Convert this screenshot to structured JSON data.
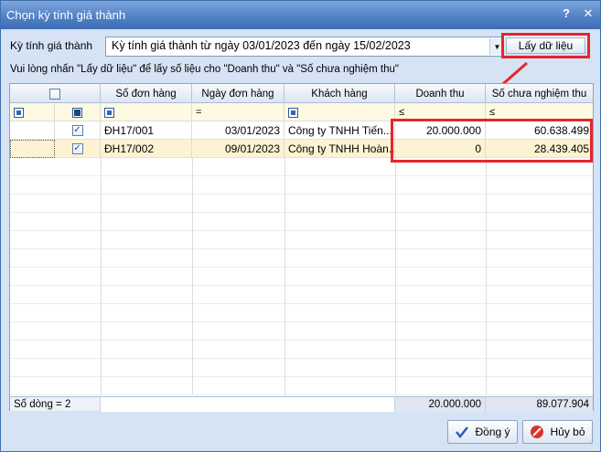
{
  "window": {
    "title": "Chọn kỳ tính giá thành",
    "help": "?",
    "close": "✕"
  },
  "period": {
    "label": "Kỳ tính giá thành",
    "value": "Kỳ tính giá thành từ ngày 03/01/2023 đến ngày 15/02/2023"
  },
  "get_data_label": "Lấy dữ liệu",
  "hint": "Vui lòng nhấn \"Lấy dữ liệu\" để lấy số liệu cho \"Doanh thu\" và \"Số chưa nghiệm thu\"",
  "columns": {
    "order_no": "Số đơn hàng",
    "order_date": "Ngày đơn hàng",
    "customer": "Khách hàng",
    "revenue": "Doanh thu",
    "unaccepted": "Số chưa nghiệm thu"
  },
  "filter": {
    "eq": "=",
    "le1": "≤",
    "le2": "≤"
  },
  "rows": [
    {
      "order_no": "ĐH17/001",
      "order_date": "03/01/2023",
      "customer": "Công ty TNHH Tiến...",
      "revenue": "20.000.000",
      "unaccepted": "60.638.499"
    },
    {
      "order_no": "ĐH17/002",
      "order_date": "09/01/2023",
      "customer": "Công ty TNHH Hoàn...",
      "revenue": "0",
      "unaccepted": "28.439.405"
    }
  ],
  "footer": {
    "row_count": "Số dòng = 2",
    "revenue_total": "20.000.000",
    "unaccepted_total": "89.077.904"
  },
  "buttons": {
    "ok": "Đồng ý",
    "cancel": "Hủy bỏ"
  },
  "colors": {
    "highlight": "#e5262b",
    "title_bar": "#4f7fc4",
    "selected_row": "#fdf3d2"
  }
}
